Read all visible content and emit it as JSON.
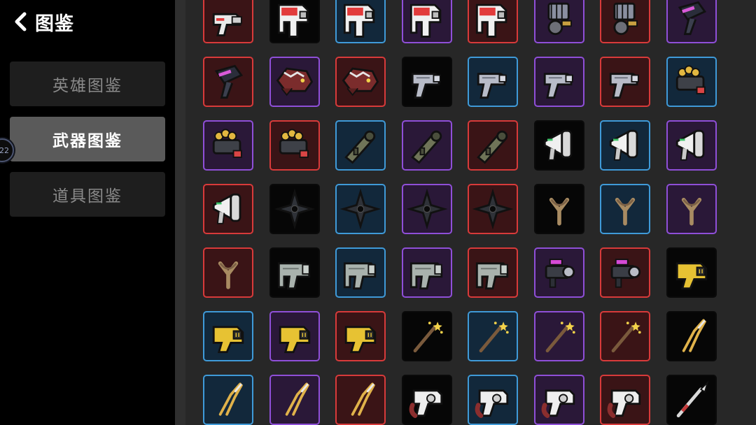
{
  "header": {
    "title": "图鉴",
    "back_icon": "chevron-left-icon"
  },
  "sidebar": {
    "items": [
      {
        "label": "英雄图鉴",
        "active": false
      },
      {
        "label": "武器图鉴",
        "active": true
      },
      {
        "label": "道具图鉴",
        "active": false
      }
    ],
    "bubble_text": "22"
  },
  "rarity_colors": {
    "red": {
      "border": "#d83a3a",
      "bg": "#3a1416"
    },
    "blue": {
      "border": "#3f9ad8",
      "bg": "#12283b"
    },
    "purple": {
      "border": "#8f4fd8",
      "bg": "#2a1838"
    },
    "black": {
      "border": "#0a0a0a",
      "bg": "#060606"
    }
  },
  "weapon_grid": {
    "rows": [
      [
        {
          "icon": "blaster",
          "rarity": "red"
        },
        {
          "icon": "red-blaster",
          "rarity": "black"
        },
        {
          "icon": "red-blaster",
          "rarity": "blue"
        },
        {
          "icon": "red-blaster",
          "rarity": "purple"
        },
        {
          "icon": "red-blaster",
          "rarity": "red"
        },
        {
          "icon": "gatling",
          "rarity": "purple"
        },
        {
          "icon": "gatling",
          "rarity": "red"
        },
        {
          "icon": "hair-dryer",
          "rarity": "purple"
        }
      ],
      [
        {
          "icon": "hair-dryer",
          "rarity": "red"
        },
        {
          "icon": "dragon-gun",
          "rarity": "purple"
        },
        {
          "icon": "dragon-gun",
          "rarity": "red"
        },
        {
          "icon": "pistol",
          "rarity": "black"
        },
        {
          "icon": "pistol",
          "rarity": "blue"
        },
        {
          "icon": "pistol",
          "rarity": "purple"
        },
        {
          "icon": "pistol",
          "rarity": "red"
        },
        {
          "icon": "treasure-cannon",
          "rarity": "blue"
        }
      ],
      [
        {
          "icon": "treasure-cannon",
          "rarity": "purple"
        },
        {
          "icon": "treasure-cannon",
          "rarity": "red"
        },
        {
          "icon": "bazooka",
          "rarity": "blue"
        },
        {
          "icon": "bazooka",
          "rarity": "purple"
        },
        {
          "icon": "bazooka",
          "rarity": "red"
        },
        {
          "icon": "megaphone",
          "rarity": "black"
        },
        {
          "icon": "megaphone",
          "rarity": "blue"
        },
        {
          "icon": "megaphone",
          "rarity": "purple"
        }
      ],
      [
        {
          "icon": "megaphone",
          "rarity": "red"
        },
        {
          "icon": "shuriken",
          "rarity": "black"
        },
        {
          "icon": "shuriken",
          "rarity": "blue"
        },
        {
          "icon": "shuriken",
          "rarity": "purple"
        },
        {
          "icon": "shuriken",
          "rarity": "red"
        },
        {
          "icon": "slingshot",
          "rarity": "black"
        },
        {
          "icon": "slingshot",
          "rarity": "blue"
        },
        {
          "icon": "slingshot",
          "rarity": "purple"
        }
      ],
      [
        {
          "icon": "slingshot",
          "rarity": "red"
        },
        {
          "icon": "nail-gun",
          "rarity": "black"
        },
        {
          "icon": "nail-gun",
          "rarity": "blue"
        },
        {
          "icon": "nail-gun",
          "rarity": "purple"
        },
        {
          "icon": "nail-gun",
          "rarity": "red"
        },
        {
          "icon": "scope-gun",
          "rarity": "purple"
        },
        {
          "icon": "scope-gun",
          "rarity": "red"
        },
        {
          "icon": "taser",
          "rarity": "black"
        }
      ],
      [
        {
          "icon": "taser",
          "rarity": "blue"
        },
        {
          "icon": "taser",
          "rarity": "purple"
        },
        {
          "icon": "taser",
          "rarity": "red"
        },
        {
          "icon": "magic-wand",
          "rarity": "black"
        },
        {
          "icon": "magic-wand",
          "rarity": "blue"
        },
        {
          "icon": "magic-wand",
          "rarity": "purple"
        },
        {
          "icon": "magic-wand",
          "rarity": "red"
        },
        {
          "icon": "shears",
          "rarity": "black"
        }
      ],
      [
        {
          "icon": "shears",
          "rarity": "blue"
        },
        {
          "icon": "shears",
          "rarity": "purple"
        },
        {
          "icon": "shears",
          "rarity": "red"
        },
        {
          "icon": "revolver",
          "rarity": "black"
        },
        {
          "icon": "revolver",
          "rarity": "blue"
        },
        {
          "icon": "revolver",
          "rarity": "purple"
        },
        {
          "icon": "revolver",
          "rarity": "red"
        },
        {
          "icon": "spear",
          "rarity": "black"
        }
      ]
    ]
  }
}
